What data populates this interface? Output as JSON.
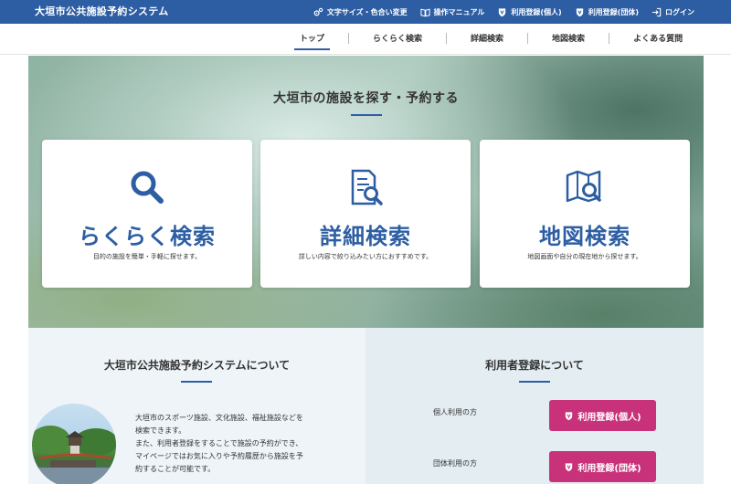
{
  "header": {
    "site_title": "大垣市公共施設予約システム",
    "links": [
      {
        "label": "文字サイズ・色合い変更",
        "icon": "settings-gear-icon"
      },
      {
        "label": "操作マニュアル",
        "icon": "book-icon"
      },
      {
        "label": "利用登録(個人)",
        "icon": "shield-icon"
      },
      {
        "label": "利用登録(団体)",
        "icon": "shield-icon"
      },
      {
        "label": "ログイン",
        "icon": "login-door-icon"
      }
    ]
  },
  "nav": {
    "items": [
      "トップ",
      "らくらく検索",
      "詳細検索",
      "地図検索",
      "よくある質問"
    ],
    "active": "トップ"
  },
  "hero": {
    "title": "大垣市の施設を探す・予約する",
    "cards": [
      {
        "title": "らくらく検索",
        "desc": "目的の施設を簡単・手軽に探せます。",
        "icon": "magnifier-icon"
      },
      {
        "title": "詳細検索",
        "desc": "詳しい内容で絞り込みたい方におすすめです。",
        "icon": "document-search-icon"
      },
      {
        "title": "地図検索",
        "desc": "地図画面や自分の現在地から探せます。",
        "icon": "map-search-icon"
      }
    ]
  },
  "about": {
    "title": "大垣市公共施設予約システムについて",
    "text_lines": [
      "大垣市のスポーツ施設、文化施設、福祉施設などを",
      "検索できます。",
      "また、利用者登録をすることで施設の予約ができ、",
      "マイページではお気に入りや予約履歴から施設を予",
      "約することが可能です。"
    ]
  },
  "registration": {
    "title": "利用者登録について",
    "rows": [
      {
        "label": "個人利用の方",
        "button": "利用登録(個人)"
      },
      {
        "label": "団体利用の方",
        "button": "利用登録(団体)"
      }
    ]
  },
  "colors": {
    "primary": "#2d5ea3",
    "accent": "#c8327a"
  }
}
